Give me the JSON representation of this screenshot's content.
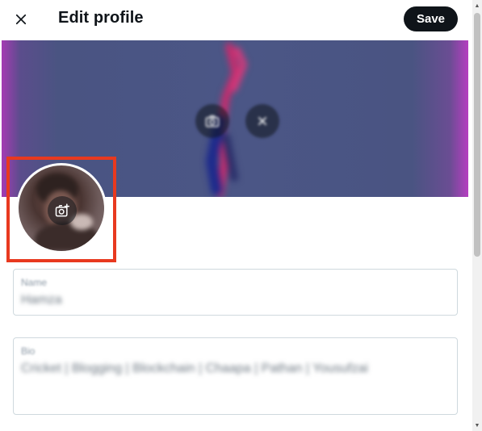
{
  "header": {
    "title": "Edit profile",
    "save_label": "Save",
    "close_icon": "close-icon"
  },
  "banner": {
    "camera_icon": "camera-icon",
    "remove_icon": "close-icon"
  },
  "avatar": {
    "camera_icon": "camera-add-icon",
    "highlight_color": "#e8391f"
  },
  "fields": {
    "name": {
      "label": "Name",
      "value": "Hamza"
    },
    "bio": {
      "label": "Bio",
      "value": "Cricket | Blogging | Blockchain | Chaapa | Pathan | Yousufzai"
    }
  },
  "colors": {
    "primary_button": "#0f1419",
    "field_border": "#cfd9de",
    "banner_base": "#4b5686",
    "banner_edge": "#b53ec0"
  }
}
